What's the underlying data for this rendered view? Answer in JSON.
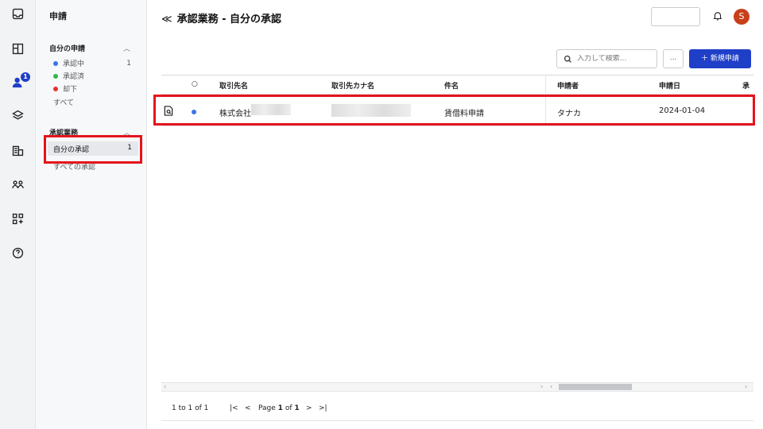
{
  "nav": {
    "title": "申請",
    "my_requests": {
      "title": "自分の申請",
      "items": [
        {
          "label": "承認中",
          "count": "1",
          "color": "#3b73e8"
        },
        {
          "label": "承認済",
          "count": "",
          "color": "#2eb84a"
        },
        {
          "label": "却下",
          "count": "",
          "color": "#e23232"
        }
      ],
      "all_label": "すべて"
    },
    "approval": {
      "title": "承認業務",
      "mine_label": "自分の承認",
      "mine_count": "1",
      "all_label": "すべての承認"
    }
  },
  "rail": {
    "badge": "1",
    "icons": [
      "inbox-icon",
      "dashboard-icon",
      "users-icon",
      "layers-icon",
      "building-icon",
      "team-icon",
      "apps-add-icon",
      "help-icon"
    ]
  },
  "header": {
    "back_icon": "≪",
    "title": "承認業務 - 自分の承認",
    "avatar": "S"
  },
  "toolbar": {
    "search_placeholder": "入力して検索...",
    "more_label": "...",
    "new_label": "＋ 新規申請"
  },
  "table": {
    "columns": [
      "取引先名",
      "取引先カナ名",
      "件名",
      "申請者",
      "申請日",
      "承"
    ],
    "rows": [
      {
        "status_color": "#3b73e8",
        "company": "株式会社",
        "kana": "",
        "subject": "賃借料申請",
        "applicant": "タナカ",
        "date": "2024-01-04"
      }
    ]
  },
  "pager": {
    "range": "1 to 1 of 1",
    "first": "|<",
    "prev": "<",
    "page_word": "Page",
    "page": "1",
    "of_word": "of",
    "total": "1",
    "next": ">",
    "last": ">|"
  },
  "colors": {
    "accent": "#1f3fc9",
    "highlight": "#e4141c",
    "avatar": "#c8401a"
  }
}
